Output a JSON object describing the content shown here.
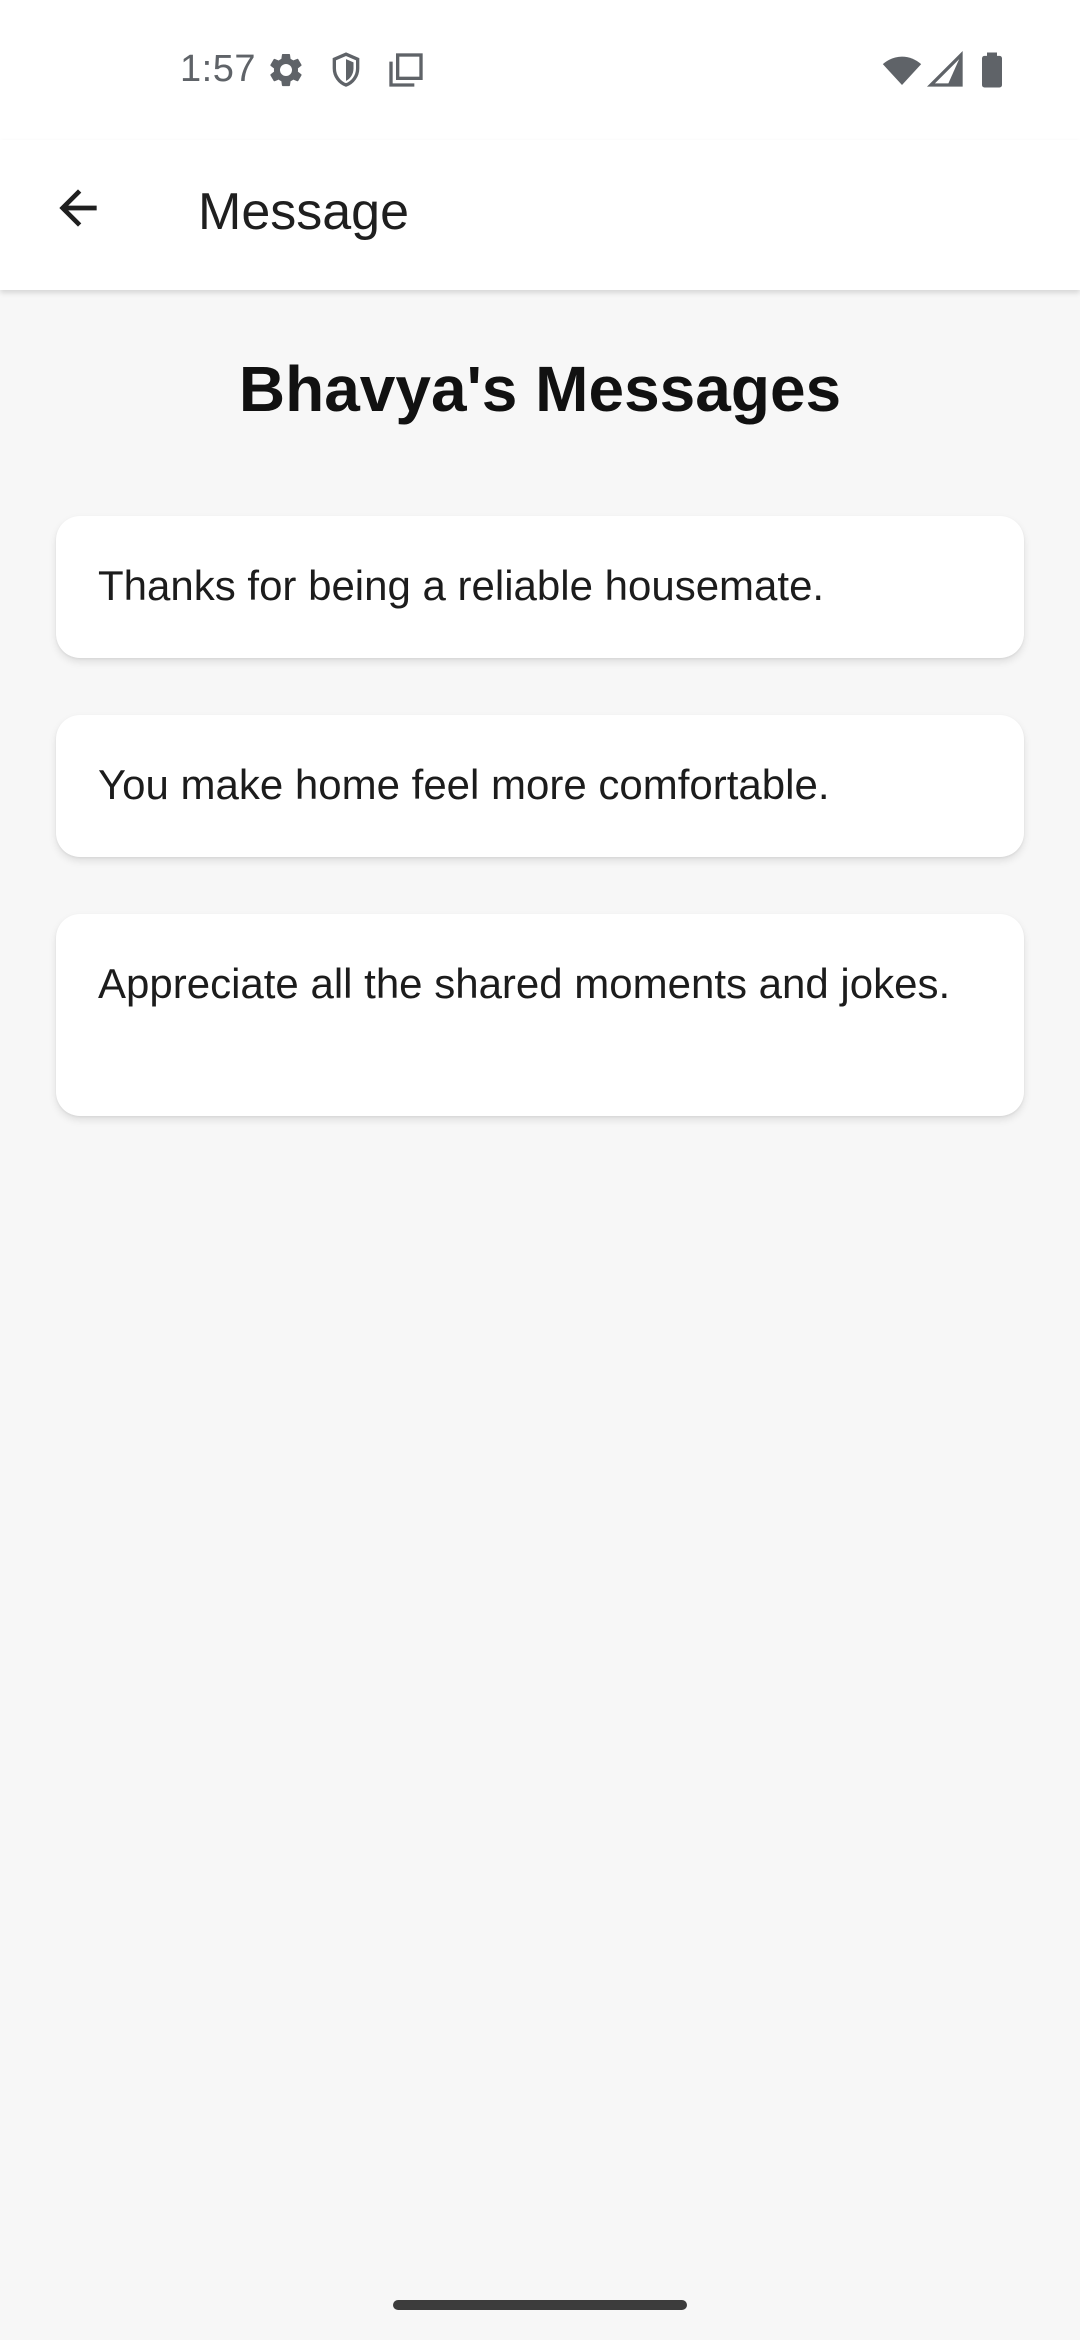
{
  "status_bar": {
    "time": "1:57",
    "icons_left": [
      "settings-icon",
      "shield-icon",
      "screenshot-icon"
    ],
    "icons_right": [
      "wifi-icon",
      "signal-icon",
      "battery-icon"
    ]
  },
  "app_bar": {
    "back_icon": "arrow-back-icon",
    "title": "Message"
  },
  "main": {
    "heading": "Bhavya's Messages",
    "messages": [
      {
        "text": "Thanks for being a reliable housemate."
      },
      {
        "text": "You make home feel more comfortable."
      },
      {
        "text": "Appreciate all the shared moments and jokes."
      }
    ]
  },
  "colors": {
    "background": "#f7f7f7",
    "surface": "#ffffff",
    "text_primary": "#1c1c1c",
    "status_text": "#5f6368"
  }
}
